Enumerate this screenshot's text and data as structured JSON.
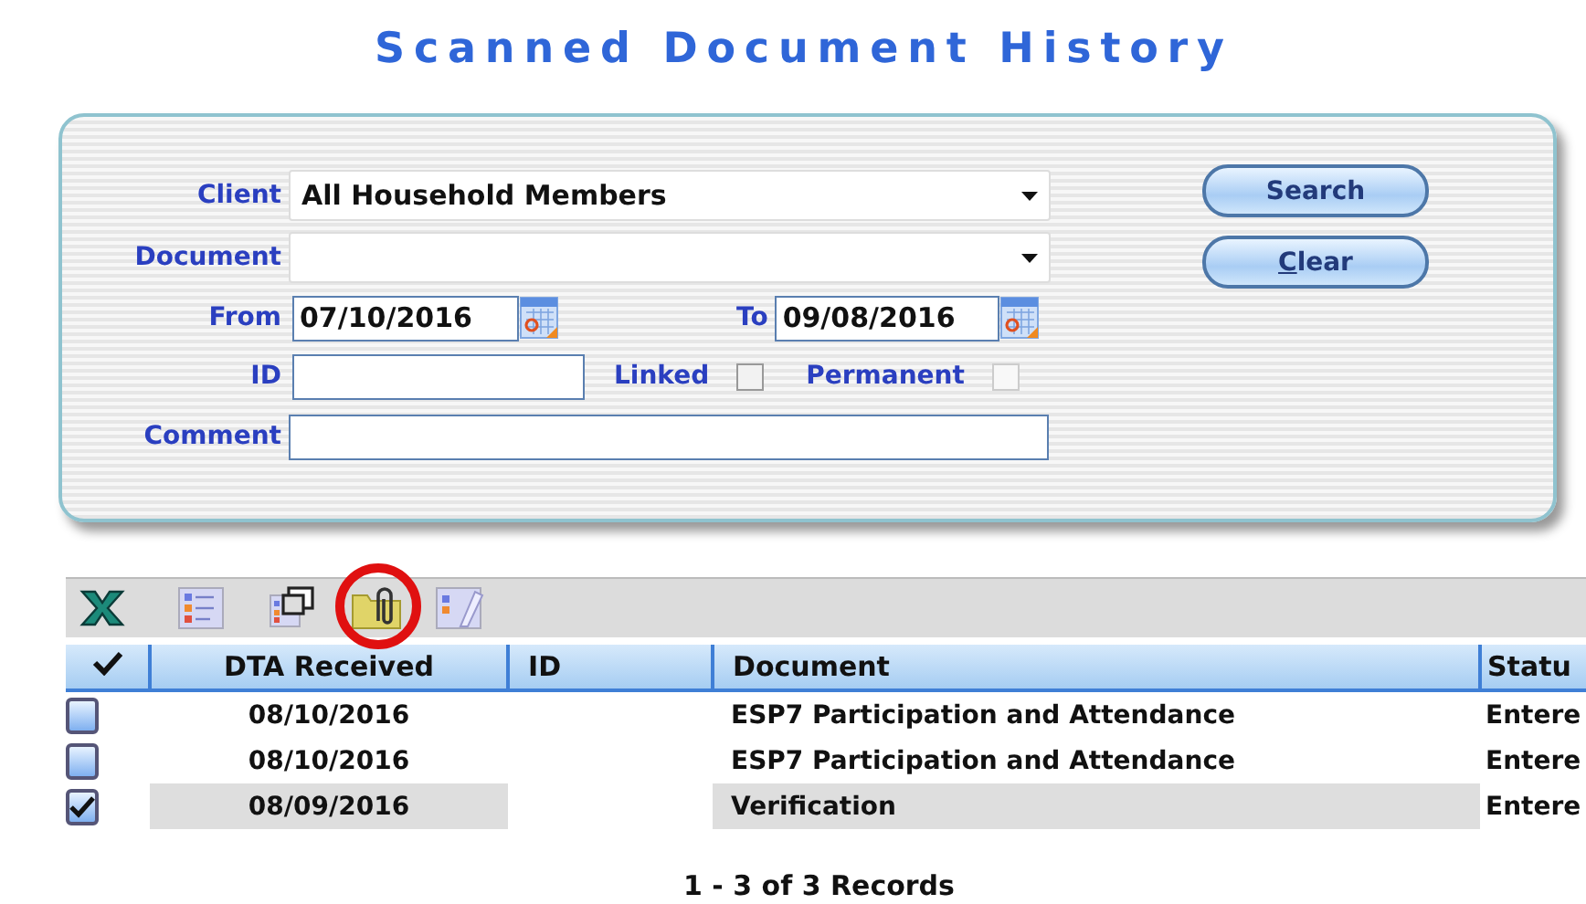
{
  "page_title": "Scanned Document History",
  "search": {
    "client": {
      "label": "Client",
      "value": "All Household Members"
    },
    "document": {
      "label": "Document"
    },
    "from": {
      "label": "From",
      "value": "07/10/2016"
    },
    "to": {
      "label": "To",
      "value": "09/08/2016"
    },
    "id": {
      "label": "ID"
    },
    "linked": {
      "label": "Linked",
      "checked": false,
      "disabled": false
    },
    "permanent": {
      "label": "Permanent",
      "checked": false,
      "disabled": true
    },
    "comment": {
      "label": "Comment"
    },
    "buttons": [
      {
        "label": "Search",
        "underline_first": false
      },
      {
        "label": "Clear",
        "underline_first": true
      }
    ]
  },
  "toolbar": [
    {
      "kind": "excel",
      "highlighted": false
    },
    {
      "kind": "list",
      "highlighted": false
    },
    {
      "kind": "copy",
      "highlighted": false
    },
    {
      "kind": "attach",
      "highlighted": true
    },
    {
      "kind": "edit",
      "highlighted": false
    }
  ],
  "table": {
    "columns": [
      "DTA Received",
      "ID",
      "Document",
      "Statu"
    ],
    "rows": [
      {
        "checked": false,
        "selected": false,
        "dta_received": "08/10/2016",
        "document": "ESP7 Participation and Attendance",
        "status": "Entere"
      },
      {
        "checked": false,
        "selected": false,
        "dta_received": "08/10/2016",
        "document": "ESP7 Participation and Attendance",
        "status": "Entere"
      },
      {
        "checked": true,
        "selected": true,
        "dta_received": "08/09/2016",
        "document": "Verification",
        "status": "Entere"
      }
    ]
  },
  "records": "1 - 3 of 3 Records"
}
